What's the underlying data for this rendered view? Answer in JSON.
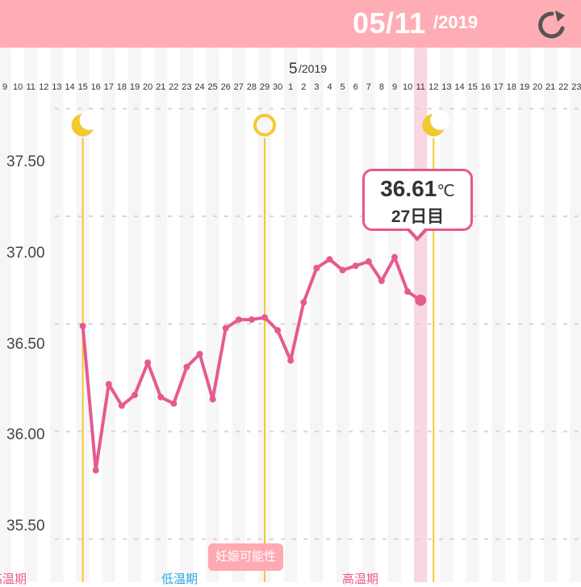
{
  "header": {
    "date": "05/11",
    "year": "/2019",
    "refresh_icon": "refresh-icon",
    "background_color": "#ffadb5"
  },
  "month_label": {
    "month": "5",
    "year": "/2019"
  },
  "badge": {
    "label": "妊娠可能性"
  },
  "tooltip": {
    "value": "36.61",
    "unit": "℃",
    "day": "27日目"
  },
  "phases": {
    "left": "高温期",
    "low": "低温期",
    "high": "高温期"
  },
  "markers": [
    {
      "date": "4/15",
      "icon": "crescent-moon-icon"
    },
    {
      "date": "4/29",
      "icon": "circle-ovulation-icon"
    },
    {
      "date": "5/12",
      "icon": "crescent-moon-icon"
    }
  ],
  "colors": {
    "line": "#e65a90",
    "marker_line": "#f3c930",
    "today_band": "#f9d7e2",
    "saturday": "#2aa7e3",
    "sunday": "#f05d86"
  },
  "chart_data": {
    "type": "line",
    "x_ticks": [
      "9",
      "10",
      "11",
      "12",
      "13",
      "14",
      "15",
      "16",
      "17",
      "18",
      "19",
      "20",
      "21",
      "22",
      "23",
      "24",
      "25",
      "26",
      "27",
      "28",
      "29",
      "30",
      "1",
      "2",
      "3",
      "4",
      "5",
      "6",
      "7",
      "8",
      "9",
      "10",
      "11",
      "12",
      "13",
      "14",
      "15",
      "16",
      "17",
      "18",
      "19",
      "20",
      "21",
      "22",
      "23"
    ],
    "x_tick_kind": [
      "",
      "",
      "",
      "",
      "sat",
      "sun",
      "",
      "",
      "",
      "",
      "",
      "sat",
      "sun",
      "",
      "",
      "",
      "",
      "",
      "sat",
      "sun",
      "",
      "",
      "",
      "",
      "",
      "sat",
      "sun",
      "",
      "",
      "",
      "",
      "",
      "",
      "",
      "",
      "",
      "",
      "",
      "",
      "",
      "sat",
      "sun",
      "",
      "",
      ""
    ],
    "today_index": 32,
    "ylim": [
      35.3,
      37.75
    ],
    "y_ticks": [
      "37.50",
      "37.00",
      "36.50",
      "36.00",
      "35.50"
    ],
    "y_tick_values": [
      37.5,
      37.0,
      36.5,
      36.0,
      35.5
    ],
    "series": [
      {
        "start_index": 6,
        "values": [
          36.49,
          35.82,
          36.22,
          36.12,
          36.17,
          36.32,
          36.16,
          36.13,
          36.3,
          36.36,
          36.15,
          36.48,
          36.52,
          36.52,
          36.53,
          36.47,
          36.33,
          36.6,
          36.76,
          36.8,
          36.75,
          36.77,
          36.79,
          36.7,
          36.81,
          36.65,
          36.61
        ]
      }
    ],
    "grid": true
  }
}
